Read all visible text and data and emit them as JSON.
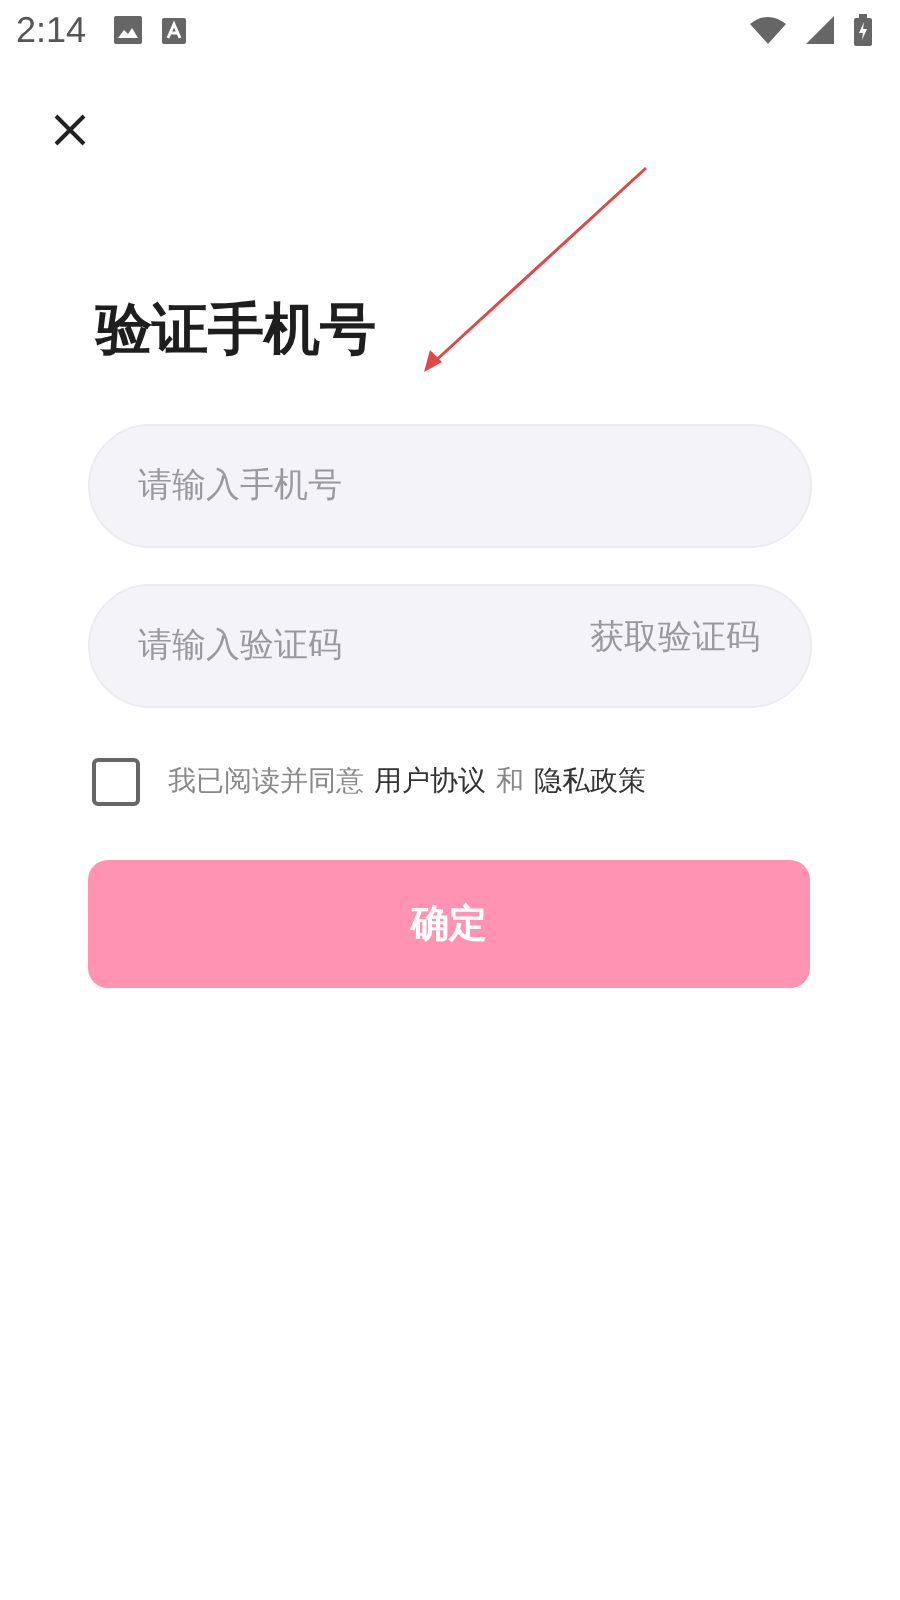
{
  "status_bar": {
    "time": "2:14"
  },
  "title": "验证手机号",
  "phone_field": {
    "placeholder": "请输入手机号"
  },
  "code_field": {
    "placeholder": "请输入验证码",
    "action": "获取验证码"
  },
  "agreement": {
    "checked": false,
    "prefix": "我已阅读并同意",
    "link_1": "用户协议",
    "joiner": "和",
    "link_2": "隐私政策"
  },
  "confirm_button": {
    "label": "确定",
    "disabled": true
  }
}
